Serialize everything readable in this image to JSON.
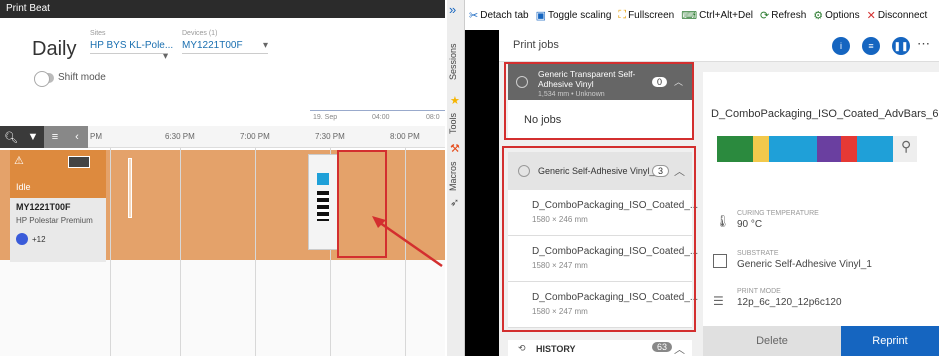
{
  "left": {
    "window_title": "Print Beat",
    "view": "Daily",
    "sites_label": "Sites",
    "site_value": "HP BYS KL-Pole...",
    "devices_label": "Devices (1)",
    "device_value": "MY1221T00F",
    "shift_mode": "Shift mode",
    "date_label": "19. Sep",
    "time_0400": "04:00",
    "time_08": "08:0",
    "ticks": [
      "PM",
      "6:30 PM",
      "7:00 PM",
      "7:30 PM",
      "8:00 PM"
    ],
    "device_card": {
      "status": "Idle",
      "name": "MY1221T00F",
      "model": "HP Polestar Premium",
      "count": "+12"
    }
  },
  "side_tabs": [
    "Sessions",
    "Tools",
    "Macros"
  ],
  "toolbar": {
    "detach": "Detach tab",
    "toggle_scaling": "Toggle scaling",
    "fullscreen": "Fullscreen",
    "ctrl_alt_del": "Ctrl+Alt+Del",
    "refresh": "Refresh",
    "options": "Options",
    "disconnect": "Disconnect"
  },
  "panel": {
    "title": "Print jobs",
    "group1": {
      "name": "Generic Transparent Self-Adhesive Vinyl",
      "sub": "1,534 mm • Unknown",
      "count": "0",
      "empty": "No jobs"
    },
    "group2": {
      "name": "Generic Self-Adhesive Vinyl_1",
      "count": "3"
    },
    "jobs": [
      {
        "name": "D_ComboPackaging_ISO_Coated_...",
        "dim": "1580 × 246 mm"
      },
      {
        "name": "D_ComboPackaging_ISO_Coated_...",
        "dim": "1580 × 247 mm"
      },
      {
        "name": "D_ComboPackaging_ISO_Coated_...",
        "dim": "1580 × 247 mm"
      }
    ],
    "history": "HISTORY",
    "history_count": "63"
  },
  "detail": {
    "title": "D_ComboPackaging_ISO_Coated_AdvBars_6...",
    "curing_label": "CURING TEMPERATURE",
    "curing_value": "90 °C",
    "substrate_label": "SUBSTRATE",
    "substrate_value": "Generic Self-Adhesive Vinyl_1",
    "mode_label": "PRINT MODE",
    "mode_value": "12p_6c_120_12p6c120",
    "delete": "Delete",
    "reprint": "Reprint"
  }
}
